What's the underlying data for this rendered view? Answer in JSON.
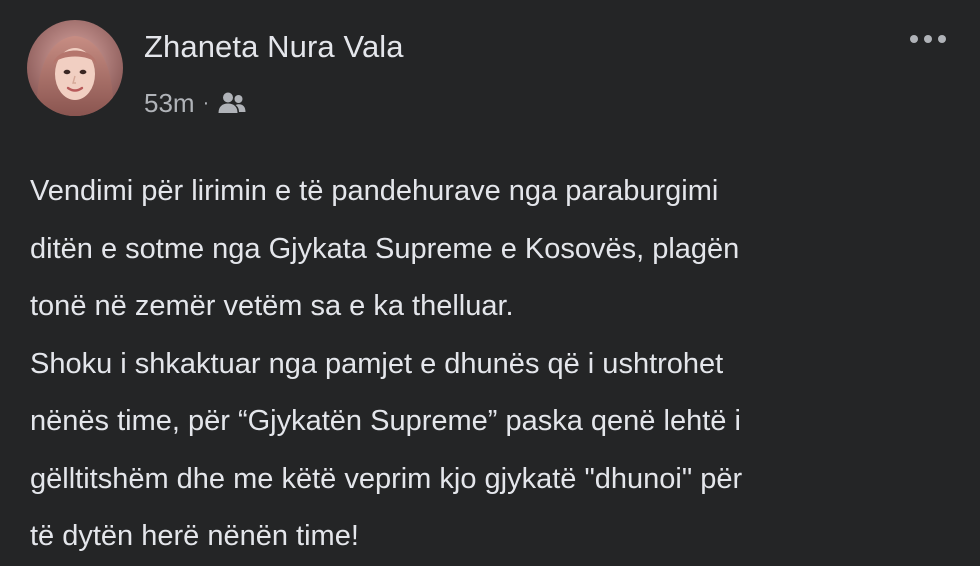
{
  "author": {
    "name": "Zhaneta Nura Vala",
    "avatar_icon": "profile-photo"
  },
  "meta": {
    "timestamp": "53m",
    "separator": "·",
    "audience_icon": "friends-icon"
  },
  "menu": {
    "icon": "more-options-icon"
  },
  "post": {
    "lines": [
      "Vendimi për lirimin e të pandehurave nga paraburgimi",
      "ditën e sotme nga Gjykata Supreme e Kosovës, plagën",
      "tonë në zemër vetëm sa e ka thelluar.",
      "Shoku i shkaktuar nga pamjet e dhunës që i ushtrohet",
      "nënës time, për “Gjykatën Supreme” paska qenë lehtë i",
      "gëlltitshëm dhe me këtë veprim kjo gjykatë \"dhunoi\" për",
      "të dytën herë nënën time!"
    ]
  },
  "colors": {
    "background": "#242526",
    "primary_text": "#e4e6eb",
    "secondary_text": "#b0b3b8"
  }
}
